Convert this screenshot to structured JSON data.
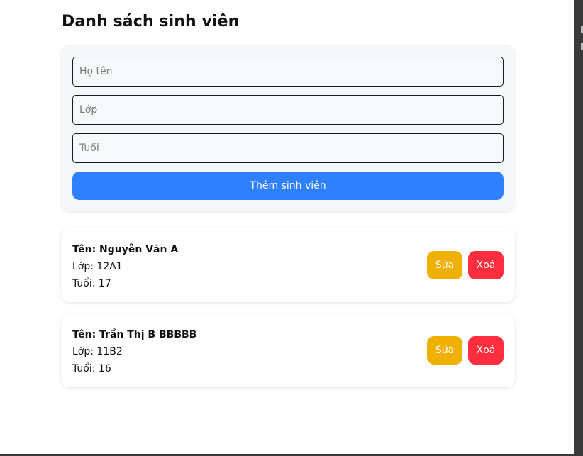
{
  "page": {
    "title": "Danh sách sinh viên"
  },
  "form": {
    "name_placeholder": "Họ tên",
    "class_placeholder": "Lớp",
    "age_placeholder": "Tuổi",
    "name_value": "",
    "class_value": "",
    "age_value": "",
    "add_label": "Thêm sinh viên"
  },
  "students": [
    {
      "name_line": "Tên: Nguyễn Văn A",
      "class_line": "Lớp: 12A1",
      "age_line": "Tuổi: 17",
      "edit_label": "Sửa",
      "delete_label": "Xoá"
    },
    {
      "name_line": "Tên: Trần Thị B BBBBB",
      "class_line": "Lớp: 11B2",
      "age_line": "Tuổi: 16",
      "edit_label": "Sửa",
      "delete_label": "Xoá"
    }
  ],
  "colors": {
    "primary": "#2f80ff",
    "edit": "#f0b000",
    "delete": "#ff2e3f",
    "card_bg": "#f5f6f8"
  }
}
